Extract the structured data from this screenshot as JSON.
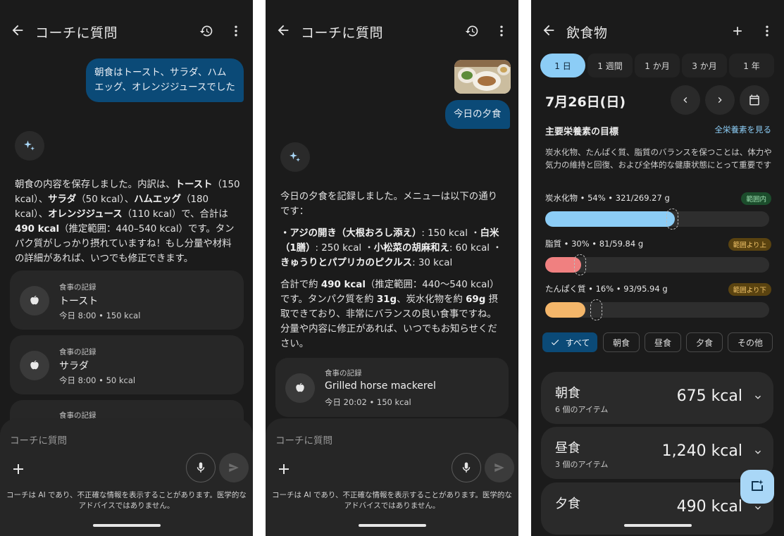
{
  "colors": {
    "background": "#1b1b1b",
    "user_bubble": "#0b4a77",
    "accent": "#8ccdf6",
    "card": "#272727",
    "carbs": "#8ccdf6",
    "fat": "#f08080",
    "protein": "#f4b66a",
    "badge_in_range_bg": "#1c4d2c",
    "badge_warn_bg": "#5a4310"
  },
  "screen1": {
    "title": "コーチに質問",
    "user_message": "朝食はトースト、サラダ、ハムエッグ、オレンジジュースでした",
    "ai_parts": [
      "朝食の内容を保存しました。内訳は、",
      "トースト",
      "（150 kcal）、",
      "サラダ",
      "（50 kcal）、",
      "ハムエッグ",
      "（180 kcal）、",
      "オレンジジュース",
      "（110 kcal）で、合計は",
      "490 kcal",
      "（推定範囲：440–540 kcal）です。タンパク質がしっかり摂れていますね！もし分量や材料の詳細があれば、いつでも修正できます。"
    ],
    "cards": [
      {
        "label": "食事の記録",
        "name": "トースト",
        "sub": "今日 8:00 • 150 kcal"
      },
      {
        "label": "食事の記録",
        "name": "サラダ",
        "sub": "今日 8:00 • 50 kcal"
      },
      {
        "label": "食事の記録"
      }
    ],
    "input_placeholder": "コーチに質問",
    "disclaimer": "コーチは AI であり、不正確な情報を表示することがあります。医学的なアドバイスではありません。"
  },
  "screen2": {
    "title": "コーチに質問",
    "user_message": "今日の夕食",
    "ai_intro": "今日の夕食を記録しました。メニューは以下の通りです：",
    "menu_parts": [
      "・アジの開き（大根おろし添え）",
      ": 150 kcal ・",
      "白米（1膳）",
      ": 250 kcal ・",
      "小松菜の胡麻和え",
      ": 60 kcal ・",
      "きゅうりとパプリカのピクルス",
      ": 30 kcal"
    ],
    "summary_parts": [
      "合計で約 ",
      "490 kcal",
      "（推定範囲：440〜540 kcal）です。タンパク質を約 ",
      "31g",
      "、炭水化物を約 ",
      "69g",
      " 摂取できており、非常にバランスの良い食事ですね。分量や内容に修正があれば、いつでもお知らせください。"
    ],
    "card": {
      "label": "食事の記録",
      "name": "Grilled horse mackerel",
      "sub": "今日 20:02 • 150 kcal"
    },
    "input_placeholder": "コーチに質問",
    "disclaimer": "コーチは AI であり、不正確な情報を表示することがあります。医学的なアドバイスではありません。"
  },
  "screen3": {
    "title": "飲食物",
    "tabs": [
      "1 日",
      "1 週間",
      "1 か月",
      "3 か月",
      "1 年"
    ],
    "date": "7月26日(日)",
    "section_title": "主要栄養素の目標",
    "section_link": "全栄養素を見る",
    "description": "炭水化物、たんぱく質、脂質のバランスを保つことは、体力や気力の維持と回復、および全体的な健康状態にとって重要です",
    "nutrients": [
      {
        "label": "炭水化物 • 54% • 321/269.27 g",
        "badge": "範囲内",
        "progress": 0.58,
        "target": 0.54
      },
      {
        "label": "脂質 • 30% • 81/59.84 g",
        "badge": "範囲より上",
        "progress": 0.16,
        "target": 0.13
      },
      {
        "label": "たんぱく質 • 16% • 93/95.94 g",
        "badge": "範囲より下",
        "progress": 0.18,
        "target": 0.2
      }
    ],
    "filters": [
      "すべて",
      "朝食",
      "昼食",
      "夕食",
      "その他"
    ],
    "meals": [
      {
        "name": "朝食",
        "items": "6 個のアイテム",
        "kcal": "675 kcal"
      },
      {
        "name": "昼食",
        "items": "3 個のアイテム",
        "kcal": "1,240 kcal"
      },
      {
        "name": "夕食",
        "kcal": "490 kcal"
      }
    ]
  }
}
